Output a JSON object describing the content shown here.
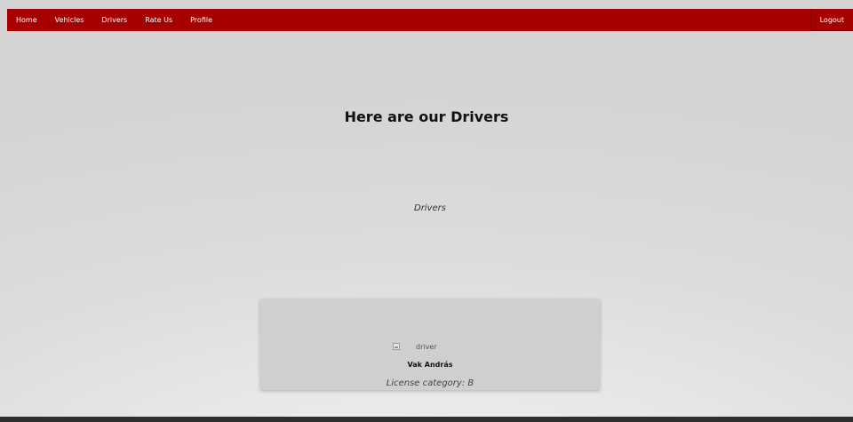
{
  "navbar": {
    "items": [
      {
        "label": "Home"
      },
      {
        "label": "Vehicles"
      },
      {
        "label": "Drivers"
      },
      {
        "label": "Rate Us"
      },
      {
        "label": "Profile"
      }
    ],
    "logout_label": "Logout",
    "background_color": "#a70000"
  },
  "main": {
    "title": "Here are our Drivers",
    "section_label": "Drivers"
  },
  "drivers": [
    {
      "photo_alt": "driver",
      "name": "Vak András",
      "license": "License category: B"
    }
  ]
}
